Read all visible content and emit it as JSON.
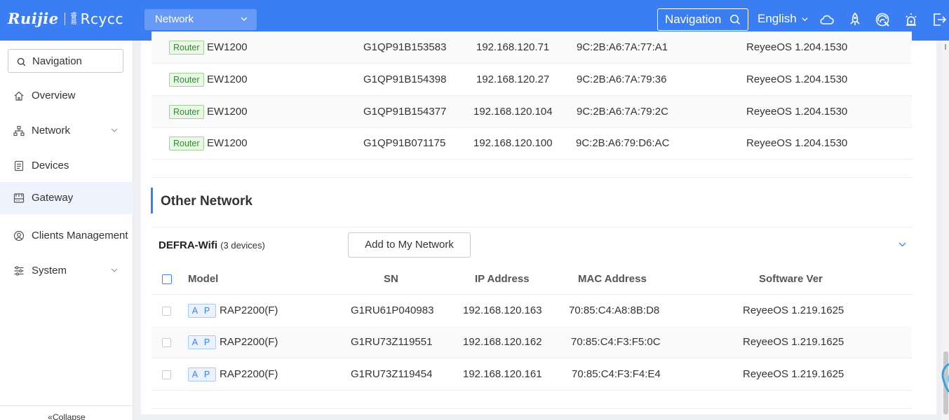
{
  "header": {
    "brand_left": "Ruijie",
    "brand_small": "睿易",
    "brand_right": "Rcycc",
    "network_select": "Network",
    "navigation_button": "Navigation",
    "language": "English"
  },
  "sidebar": {
    "search_label": "Navigation",
    "items": [
      {
        "label": "Overview",
        "icon": "home-icon"
      },
      {
        "label": "Network",
        "icon": "network-icon",
        "has_chevron": true
      },
      {
        "label": "Devices",
        "icon": "devices-icon"
      },
      {
        "label": "Gateway",
        "icon": "gateway-icon",
        "active": true
      },
      {
        "label": "Clients Management",
        "icon": "clients-icon"
      },
      {
        "label": "System",
        "icon": "system-icon",
        "has_chevron": true
      }
    ],
    "collapse_label": "Collapse"
  },
  "my_network_rows": [
    {
      "type": "Router",
      "model": "EW1200",
      "sn": "G1QP91B153583",
      "ip": "192.168.120.71",
      "mac": "9C:2B:A6:7A:77:A1",
      "software": "ReyeeOS 1.204.1530"
    },
    {
      "type": "Router",
      "model": "EW1200",
      "sn": "G1QP91B154398",
      "ip": "192.168.120.27",
      "mac": "9C:2B:A6:7A:79:36",
      "software": "ReyeeOS 1.204.1530"
    },
    {
      "type": "Router",
      "model": "EW1200",
      "sn": "G1QP91B154377",
      "ip": "192.168.120.104",
      "mac": "9C:2B:A6:7A:79:2C",
      "software": "ReyeeOS 1.204.1530"
    },
    {
      "type": "Router",
      "model": "EW1200",
      "sn": "G1QP91B071175",
      "ip": "192.168.120.100",
      "mac": "9C:2B:A6:79:D6:AC",
      "software": "ReyeeOS 1.204.1530"
    }
  ],
  "other_network": {
    "title": "Other Network",
    "group_name": "DEFRA-Wifi",
    "group_count": "(3 devices)",
    "add_button": "Add to My Network",
    "columns": {
      "model": "Model",
      "sn": "SN",
      "ip": "IP Address",
      "mac": "MAC Address",
      "software": "Software Ver"
    },
    "rows": [
      {
        "type": "A P",
        "model": "RAP2200(F)",
        "sn": "G1RU61P040983",
        "ip": "192.168.120.163",
        "mac": "70:85:C4:A8:8B:D8",
        "software": "ReyeeOS 1.219.1625"
      },
      {
        "type": "A P",
        "model": "RAP2200(F)",
        "sn": "G1RU73Z119551",
        "ip": "192.168.120.162",
        "mac": "70:85:C4:F3:F5:0C",
        "software": "ReyeeOS 1.219.1625"
      },
      {
        "type": "A P",
        "model": "RAP2200(F)",
        "sn": "G1RU73Z119454",
        "ip": "192.168.120.161",
        "mac": "70:85:C4:F3:F4:E4",
        "software": "ReyeeOS 1.219.1625"
      }
    ]
  },
  "colors": {
    "primary": "#3b7ef3",
    "router_tag": "#2e8c2e",
    "ap_tag": "#3b7ef3"
  }
}
